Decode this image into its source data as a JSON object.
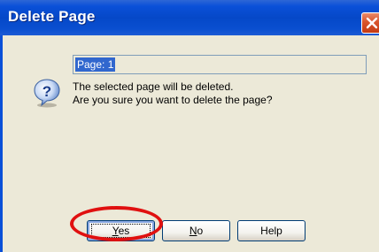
{
  "dialog": {
    "title": "Delete Page",
    "close_icon": "close-icon",
    "page_field_value": "Page: 1",
    "icon": "question-icon",
    "message_line1": "The selected page will be deleted.",
    "message_line2": "Are you sure you want to delete the page?",
    "buttons": {
      "yes": {
        "label": "Yes",
        "mnemonic": "Y",
        "rest": "es"
      },
      "no": {
        "label": "No",
        "mnemonic": "N",
        "rest": "o"
      },
      "help": {
        "label": "Help"
      }
    },
    "highlight_color": "#e01010"
  },
  "colors": {
    "titlebar": "#0548c8",
    "client_bg": "#ece9d8",
    "selection": "#3167ce",
    "close_button": "#d8542b"
  }
}
